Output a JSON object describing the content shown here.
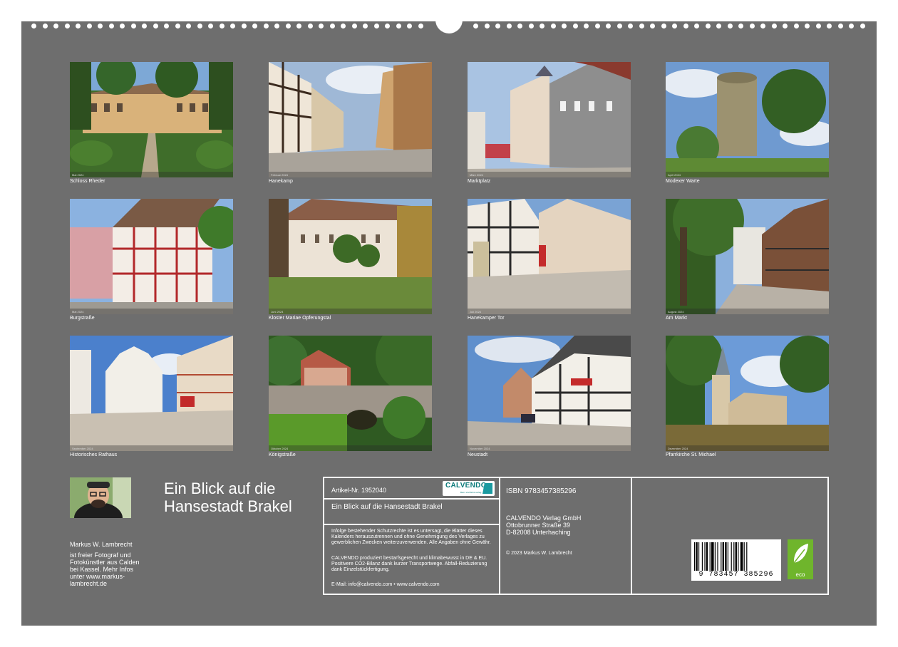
{
  "calendar": {
    "tiles": [
      {
        "caption": "Schloss Rheder",
        "strip": "Mai 2024"
      },
      {
        "caption": "Hanekamp",
        "strip": "Februar 2024"
      },
      {
        "caption": "Marktplatz",
        "strip": "März 2024"
      },
      {
        "caption": "Modexer Warte",
        "strip": "April 2024"
      },
      {
        "caption": "Burgstraße",
        "strip": "Mai 2024"
      },
      {
        "caption": "Kloster Mariae Opferungstal",
        "strip": "Juni 2024"
      },
      {
        "caption": "Hanekamper Tor",
        "strip": "Juli 2024"
      },
      {
        "caption": "Am Markt",
        "strip": "August 2024"
      },
      {
        "caption": "Historisches Rathaus",
        "strip": "September 2024"
      },
      {
        "caption": "Königstraße",
        "strip": "Oktober 2024"
      },
      {
        "caption": "Neustadt",
        "strip": "November 2024"
      },
      {
        "caption": "Pfarrkirche St. Michael",
        "strip": "Dezember 2024"
      }
    ]
  },
  "title": {
    "line1": "Ein Blick auf die",
    "line2": "Hansestadt Brakel"
  },
  "author": {
    "name": "Markus W. Lambrecht",
    "bio": "ist freier Fotograf und Fotokünstler aus Calden bei Kassel. Mehr Infos unter www.markus-lambrecht.de"
  },
  "info": {
    "article": "Artikel-Nr. 1952040",
    "logo": "CALVENDO",
    "logo_sub": "Bein. tcs/cbnbs verlag",
    "book_title": "Ein Blick auf die Hansestadt Brakel",
    "legal1": "Infolge bestehender Schutzrechte ist es untersagt, die Blätter dieses Kalenders herauszutrennen und ohne Genehmigung des Verlages zu gewerblichen Zwecken weiterzuverwenden. Alle Angaben ohne Gewähr.",
    "legal2": "CALVENDO produziert bestarfsgerecht und klimabewusst in DE & EU. Positivere CO2-Bilanz dank kurzer Transportwege. Abfall-Reduzierung dank Einzelstückfertigung.",
    "email": "E-Mail: info@calvendo.com • www.calvendo.com",
    "isbn": "ISBN 9783457385296",
    "publisher1": "CALVENDO Verlag GmbH",
    "publisher2": "Ottobrunner Straße 39",
    "publisher3": "D-82008 Unterhaching",
    "copyright": "© 2023 Markus W. Lambrecht",
    "barcode_digits": "9  783457  385296",
    "eco": "eco"
  },
  "colors": {
    "board": "#6e6e6e",
    "text": "#ffffff",
    "eco": "#6fb52c",
    "calvendo": "#0a7a7a"
  }
}
